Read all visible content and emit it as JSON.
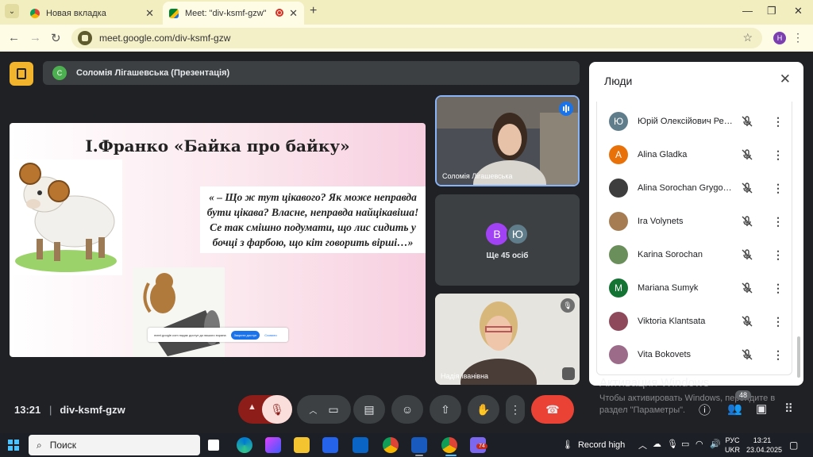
{
  "browser": {
    "tabs": [
      {
        "title": "Новая вкладка",
        "active": false
      },
      {
        "title": "Meet: \"div-ksmf-gzw\"",
        "active": true
      }
    ],
    "url": "meet.google.com/div-ksmf-gzw",
    "profile_initial": "H"
  },
  "meet": {
    "presenter_initial": "С",
    "presenter_label": "Соломія Лігашевська (Презентація)",
    "slide": {
      "title": "І.Франко «Байка про байку»",
      "quote": "« – Що ж тут цікавого? Як може неправда бути цікава? Власне, неправда найцікавіша! Се так смішно подумати, що лис сидить у бочці з фарбою, що кіт говорить вірші…»",
      "share_banner_text": "meet.google.com надає доступ до вашого екрана",
      "share_banner_stop": "Закрити доступ",
      "share_banner_hide": "Сховати"
    },
    "tiles": {
      "main_speaker": "Соломія Лігашевська",
      "others_initials": [
        "В",
        "Ю"
      ],
      "others_label": "Ще 45 осіб",
      "second_speaker": "Надія Іванівна"
    },
    "bottom": {
      "time": "13:21",
      "meeting_code": "div-ksmf-gzw",
      "people_count": "48"
    },
    "watermark": {
      "line1": "Активация Windows",
      "line2": "Чтобы активировать Windows, перейдите в раздел \"Параметры\"."
    }
  },
  "people_panel": {
    "title": "Люди",
    "participants": [
      {
        "initial": "Ю",
        "name": "Юрій Олексійович Рев...",
        "color": "#607d8b",
        "photo": false
      },
      {
        "initial": "A",
        "name": "Alina Gladka",
        "color": "#e8710a",
        "photo": false
      },
      {
        "initial": "",
        "name": "Alina Sorochan Grygore...",
        "color": "#3d3d3d",
        "photo": true
      },
      {
        "initial": "",
        "name": "Ira Volynets",
        "color": "#a67c52",
        "photo": true
      },
      {
        "initial": "",
        "name": "Karina Sorochan",
        "color": "#6a8f5a",
        "photo": true
      },
      {
        "initial": "M",
        "name": "Mariana Sumyk",
        "color": "#137333",
        "photo": false
      },
      {
        "initial": "",
        "name": "Viktoria Klantsata",
        "color": "#8e4a5a",
        "photo": true
      },
      {
        "initial": "",
        "name": "Vita Bokovets",
        "color": "#9c6b8a",
        "photo": true
      }
    ]
  },
  "taskbar": {
    "search_label": "Поиск",
    "weather": "Record high",
    "lang_line1": "РУС",
    "lang_line2": "UKR",
    "clock": "13:21",
    "date": "23.04.2025",
    "teams_badge": "74"
  }
}
